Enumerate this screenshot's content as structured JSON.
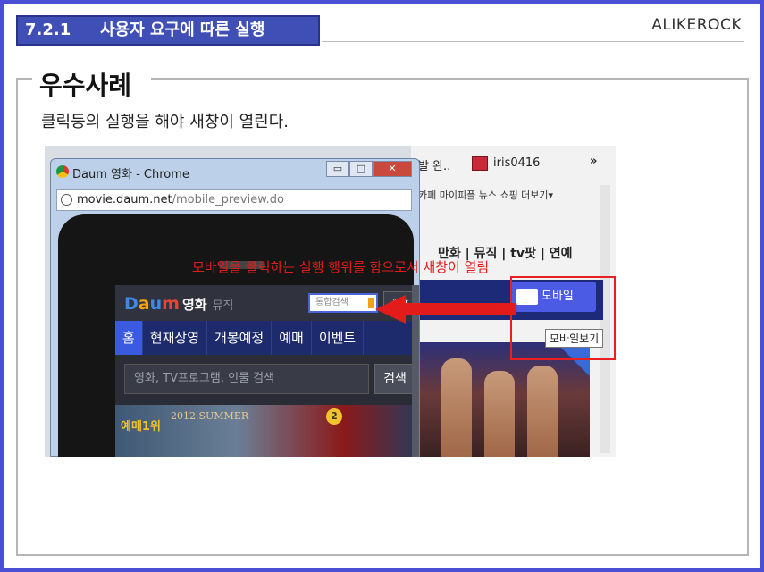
{
  "header": {
    "section_num": "7.2.1",
    "section_title": "사용자 요구에 따른 실행",
    "brand": "ALIKEROCK"
  },
  "box": {
    "title": "우수사례",
    "description": "클릭등의 실행을 해야 새창이 열린다."
  },
  "browser": {
    "window_title": "Daum 영화 - Chrome",
    "url_host": "movie.daum.net",
    "url_path": "/mobile_preview.do",
    "buttons": {
      "minimize": "▭",
      "maximize": "□",
      "close": "✕"
    }
  },
  "background_page": {
    "tab1": "발 완..",
    "tab2": "iris0416",
    "more": "»",
    "top_links": "카페  마이피플  뉴스  쇼핑  더보기▾",
    "menu": "만화 | 뮤직 | tv팟 | 연예",
    "mobile_button": "모바일",
    "tooltip": "모바일보기"
  },
  "annotation": "모바일을 클릭하는 실행 행위를 함으로서 새창이 열림",
  "mobile": {
    "logo_d": "D",
    "logo_a": "a",
    "logo_u": "u",
    "logo_m": "m",
    "logo_text": "영화",
    "logo_sub": "뮤직",
    "search_badge": "통합검색",
    "grid": "▦▾",
    "nav": [
      "홈",
      "현재상영",
      "개봉예정",
      "예매",
      "이벤트"
    ],
    "search_placeholder": "영화, TV프로그램, 인물 검색",
    "search_button": "검색",
    "banner_rank_1": "예매",
    "banner_rank_2": "1",
    "banner_rank_3": "위",
    "banner_caption": "2012.SUMMER",
    "banner_badge": "2"
  },
  "colors": {
    "frame": "#4a4fd6",
    "tag": "#3f4fb5",
    "annotation": "#e31b1b",
    "nav_active": "#3a5be0"
  }
}
